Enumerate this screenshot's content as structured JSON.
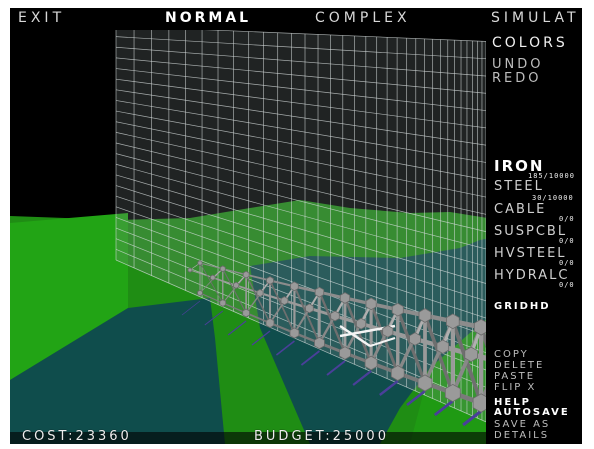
{
  "topbar": {
    "exit": "EXIT",
    "normal": "NORMAL",
    "complex": "COMPLEX",
    "simulate": "SIMULAT"
  },
  "side": {
    "colors": "COLORS",
    "undo": "UNDO",
    "redo": "REDO",
    "materials": [
      {
        "name": "IRON",
        "count": "185/10000",
        "selected": true
      },
      {
        "name": "STEEL",
        "count": "30/10000",
        "selected": false
      },
      {
        "name": "CABLE",
        "count": "0/0",
        "selected": false
      },
      {
        "name": "SUSPCBL",
        "count": "0/0",
        "selected": false
      },
      {
        "name": "HVSTEEL",
        "count": "0/0",
        "selected": false
      },
      {
        "name": "HYDRALC",
        "count": "0/0",
        "selected": false
      }
    ],
    "grid": "GRIDHD",
    "edit": {
      "copy": "COPY",
      "delete": "DELETE",
      "paste": "PASTE",
      "flip_x": "FLIP X",
      "help": "HELP",
      "autosave": "AUTOSAVE",
      "save_as": "SAVE AS",
      "details": "DETAILS"
    }
  },
  "status": {
    "cost": "COST:23360",
    "budget": "BUDGET:25000"
  },
  "colors": {
    "sky": "#000000",
    "grass": "#1f9a13",
    "water": "#0e4a4a",
    "grid": "#cfd6d6"
  }
}
